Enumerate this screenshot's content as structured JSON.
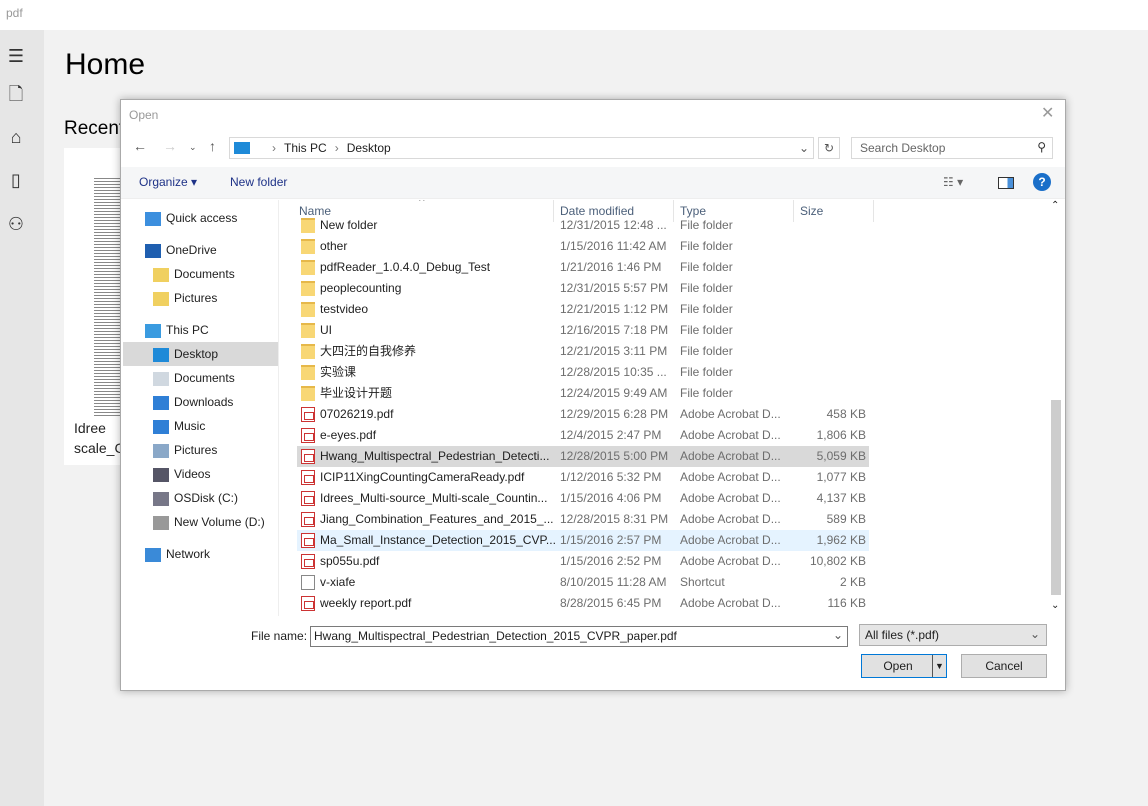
{
  "app": {
    "title": "pdf",
    "page_title": "Home",
    "section": "Recent",
    "recent_file": "Idree\nscale_C",
    "sidebar": [
      "menu-icon",
      "open-file-icon",
      "home-icon",
      "import-icon",
      "people-icon"
    ]
  },
  "dialog": {
    "title": "Open",
    "breadcrumb": [
      "This PC",
      "Desktop"
    ],
    "search_placeholder": "Search Desktop",
    "toolbar": {
      "organize": "Organize ▾",
      "new_folder": "New folder"
    },
    "nav": [
      {
        "label": "Quick access",
        "icon": "star-icon",
        "color": "#3c8fde"
      },
      {
        "label": "OneDrive",
        "icon": "cloud-icon",
        "color": "#1f5fb0"
      },
      {
        "label": "Documents",
        "icon": "sync-folder-icon",
        "color": "#f0d060",
        "sub": true
      },
      {
        "label": "Pictures",
        "icon": "sync-folder-icon",
        "color": "#f0d060",
        "sub": true
      },
      {
        "label": "This PC",
        "icon": "computer-icon",
        "color": "#3a9be0"
      },
      {
        "label": "Desktop",
        "icon": "desktop-icon",
        "color": "#1e8ad8",
        "sub": true,
        "selected": true
      },
      {
        "label": "Documents",
        "icon": "documents-icon",
        "color": "#d0d8e0",
        "sub": true
      },
      {
        "label": "Downloads",
        "icon": "downloads-icon",
        "color": "#2f7fd6",
        "sub": true
      },
      {
        "label": "Music",
        "icon": "music-icon",
        "color": "#2f7fd6",
        "sub": true
      },
      {
        "label": "Pictures",
        "icon": "pictures-icon",
        "color": "#8aa8c8",
        "sub": true
      },
      {
        "label": "Videos",
        "icon": "videos-icon",
        "color": "#556",
        "sub": true
      },
      {
        "label": "OSDisk (C:)",
        "icon": "drive-icon",
        "color": "#778",
        "sub": true
      },
      {
        "label": "New Volume (D:)",
        "icon": "drive-icon",
        "color": "#999",
        "sub": true
      },
      {
        "label": "Network",
        "icon": "network-icon",
        "color": "#3a8ad8"
      }
    ],
    "columns": [
      "Name",
      "Date modified",
      "Type",
      "Size"
    ],
    "files": [
      {
        "name": "New folder",
        "date": "12/31/2015 12:48 ...",
        "type": "File folder",
        "size": "",
        "kind": "folder"
      },
      {
        "name": "other",
        "date": "1/15/2016 11:42 AM",
        "type": "File folder",
        "size": "",
        "kind": "folder"
      },
      {
        "name": "pdfReader_1.0.4.0_Debug_Test",
        "date": "1/21/2016 1:46 PM",
        "type": "File folder",
        "size": "",
        "kind": "folder"
      },
      {
        "name": "peoplecounting",
        "date": "12/31/2015 5:57 PM",
        "type": "File folder",
        "size": "",
        "kind": "folder"
      },
      {
        "name": "testvideo",
        "date": "12/21/2015 1:12 PM",
        "type": "File folder",
        "size": "",
        "kind": "folder"
      },
      {
        "name": "UI",
        "date": "12/16/2015 7:18 PM",
        "type": "File folder",
        "size": "",
        "kind": "folder"
      },
      {
        "name": "大四汪的自我修养",
        "date": "12/21/2015 3:11 PM",
        "type": "File folder",
        "size": "",
        "kind": "folder"
      },
      {
        "name": "实验课",
        "date": "12/28/2015 10:35 ...",
        "type": "File folder",
        "size": "",
        "kind": "folder"
      },
      {
        "name": "毕业设计开题",
        "date": "12/24/2015 9:49 AM",
        "type": "File folder",
        "size": "",
        "kind": "folder"
      },
      {
        "name": "07026219.pdf",
        "date": "12/29/2015 6:28 PM",
        "type": "Adobe Acrobat D...",
        "size": "458 KB",
        "kind": "pdf"
      },
      {
        "name": "e-eyes.pdf",
        "date": "12/4/2015 2:47 PM",
        "type": "Adobe Acrobat D...",
        "size": "1,806 KB",
        "kind": "pdf"
      },
      {
        "name": "Hwang_Multispectral_Pedestrian_Detecti...",
        "date": "12/28/2015 5:00 PM",
        "type": "Adobe Acrobat D...",
        "size": "5,059 KB",
        "kind": "pdf",
        "selected": true
      },
      {
        "name": "ICIP11XingCountingCameraReady.pdf",
        "date": "1/12/2016 5:32 PM",
        "type": "Adobe Acrobat D...",
        "size": "1,077 KB",
        "kind": "pdf"
      },
      {
        "name": "Idrees_Multi-source_Multi-scale_Countin...",
        "date": "1/15/2016 4:06 PM",
        "type": "Adobe Acrobat D...",
        "size": "4,137 KB",
        "kind": "pdf"
      },
      {
        "name": "Jiang_Combination_Features_and_2015_...",
        "date": "12/28/2015 8:31 PM",
        "type": "Adobe Acrobat D...",
        "size": "589 KB",
        "kind": "pdf"
      },
      {
        "name": "Ma_Small_Instance_Detection_2015_CVP...",
        "date": "1/15/2016 2:57 PM",
        "type": "Adobe Acrobat D...",
        "size": "1,962 KB",
        "kind": "pdf",
        "hover": true
      },
      {
        "name": "sp055u.pdf",
        "date": "1/15/2016 2:52 PM",
        "type": "Adobe Acrobat D...",
        "size": "10,802 KB",
        "kind": "pdf"
      },
      {
        "name": "v-xiafe",
        "date": "8/10/2015 11:28 AM",
        "type": "Shortcut",
        "size": "2 KB",
        "kind": "lnk"
      },
      {
        "name": "weekly report.pdf",
        "date": "8/28/2015 6:45 PM",
        "type": "Adobe Acrobat D...",
        "size": "116 KB",
        "kind": "pdf"
      }
    ],
    "file_name_label": "File name:",
    "file_name": "Hwang_Multispectral_Pedestrian_Detection_2015_CVPR_paper.pdf",
    "filter": "All files (*.pdf)",
    "open": "Open",
    "cancel": "Cancel"
  }
}
